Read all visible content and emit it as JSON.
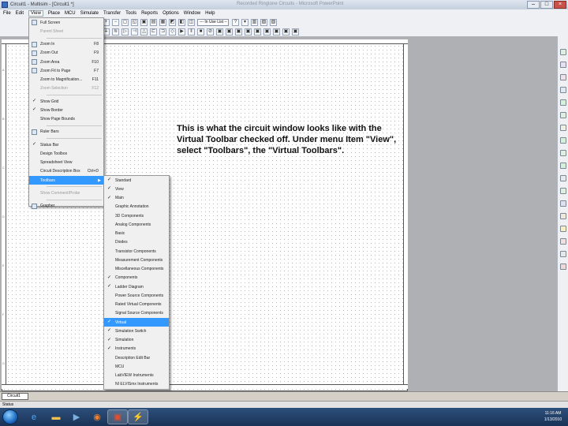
{
  "window": {
    "title": "Circuit1 - Multisim - [Circuit1 *]",
    "center_title": "Recorded Ringtone Circuits - Microsoft PowerPoint"
  },
  "menubar": {
    "items": [
      "File",
      "Edit",
      "View",
      "Place",
      "MCU",
      "Simulate",
      "Transfer",
      "Tools",
      "Reports",
      "Options",
      "Window",
      "Help"
    ]
  },
  "toolbar": {
    "in_use_list": "--- In Use List ---"
  },
  "view_menu": {
    "items": [
      {
        "label": "Full Screen",
        "shortcut": "",
        "type": "icon"
      },
      {
        "label": "Parent Sheet",
        "shortcut": "",
        "type": "disabled"
      },
      {
        "label": "Zoom In",
        "shortcut": "F8",
        "type": "icon"
      },
      {
        "label": "Zoom Out",
        "shortcut": "F9",
        "type": "icon"
      },
      {
        "label": "Zoom Area",
        "shortcut": "F10",
        "type": "icon"
      },
      {
        "label": "Zoom Fit to Page",
        "shortcut": "F7",
        "type": "icon"
      },
      {
        "label": "Zoom to Magnification...",
        "shortcut": "F11",
        "type": "plain"
      },
      {
        "label": "Zoom Selection",
        "shortcut": "F12",
        "type": "plain"
      },
      {
        "label": "Show Grid",
        "shortcut": "",
        "type": "check"
      },
      {
        "label": "Show Border",
        "shortcut": "",
        "type": "check"
      },
      {
        "label": "Show Page Bounds",
        "shortcut": "",
        "type": "plain"
      },
      {
        "label": "Ruler Bars",
        "shortcut": "",
        "type": "icon"
      },
      {
        "label": "Status Bar",
        "shortcut": "",
        "type": "check"
      },
      {
        "label": "Design Toolbox",
        "shortcut": "",
        "type": "plain"
      },
      {
        "label": "Spreadsheet View",
        "shortcut": "",
        "type": "plain"
      },
      {
        "label": "Circuit Description Box",
        "shortcut": "Ctrl+D",
        "type": "plain"
      },
      {
        "label": "Toolbars",
        "shortcut": "",
        "type": "selected"
      },
      {
        "label": "Show Comment/Probe",
        "shortcut": "",
        "type": "disabled"
      },
      {
        "label": "Grapher",
        "shortcut": "",
        "type": "icon"
      }
    ]
  },
  "toolbars_submenu": {
    "items": [
      {
        "label": "Standard",
        "checked": true,
        "selected": false
      },
      {
        "label": "View",
        "checked": true,
        "selected": false
      },
      {
        "label": "Main",
        "checked": true,
        "selected": false
      },
      {
        "label": "Graphic Annotation",
        "checked": false,
        "selected": false
      },
      {
        "label": "3D Components",
        "checked": false,
        "selected": false
      },
      {
        "label": "Analog Components",
        "checked": false,
        "selected": false
      },
      {
        "label": "Basic",
        "checked": false,
        "selected": false
      },
      {
        "label": "Diodes",
        "checked": false,
        "selected": false
      },
      {
        "label": "Transistor Components",
        "checked": false,
        "selected": false
      },
      {
        "label": "Measurement Components",
        "checked": false,
        "selected": false
      },
      {
        "label": "Miscellaneous Components",
        "checked": false,
        "selected": false
      },
      {
        "label": "Components",
        "checked": true,
        "selected": false
      },
      {
        "label": "Ladder Diagram",
        "checked": true,
        "selected": false
      },
      {
        "label": "Power Source Components",
        "checked": false,
        "selected": false
      },
      {
        "label": "Rated Virtual Components",
        "checked": false,
        "selected": false
      },
      {
        "label": "Signal Source Components",
        "checked": false,
        "selected": false
      },
      {
        "label": "Virtual",
        "checked": true,
        "selected": true
      },
      {
        "label": "Simulation Switch",
        "checked": true,
        "selected": false
      },
      {
        "label": "Simulation",
        "checked": true,
        "selected": false
      },
      {
        "label": "Instruments",
        "checked": true,
        "selected": false
      },
      {
        "label": "Description Edit Bar",
        "checked": false,
        "selected": false
      },
      {
        "label": "MCU",
        "checked": false,
        "selected": false
      },
      {
        "label": "LabVIEW Instruments",
        "checked": false,
        "selected": false
      },
      {
        "label": "NI ELVISmx Instruments",
        "checked": false,
        "selected": false
      }
    ]
  },
  "note": {
    "text": "This is what the circuit window looks like with the Virtual Toolbar checked off.  Under menu Item \"View\", select \"Toolbars\", the \"Virtual Toolbars\"."
  },
  "ruler": {
    "left_marks": [
      "A",
      "B",
      "C",
      "D",
      "E",
      "F",
      "G"
    ]
  },
  "tabbar": {
    "tab_label": "Circuit1"
  },
  "statusbar": {
    "text": "Status"
  },
  "taskbar": {
    "clock_time": "11:16 AM",
    "clock_date": "1/13/2010"
  },
  "colors": {
    "menu_highlight": "#3399ff",
    "taskbar": "#1a3356"
  }
}
